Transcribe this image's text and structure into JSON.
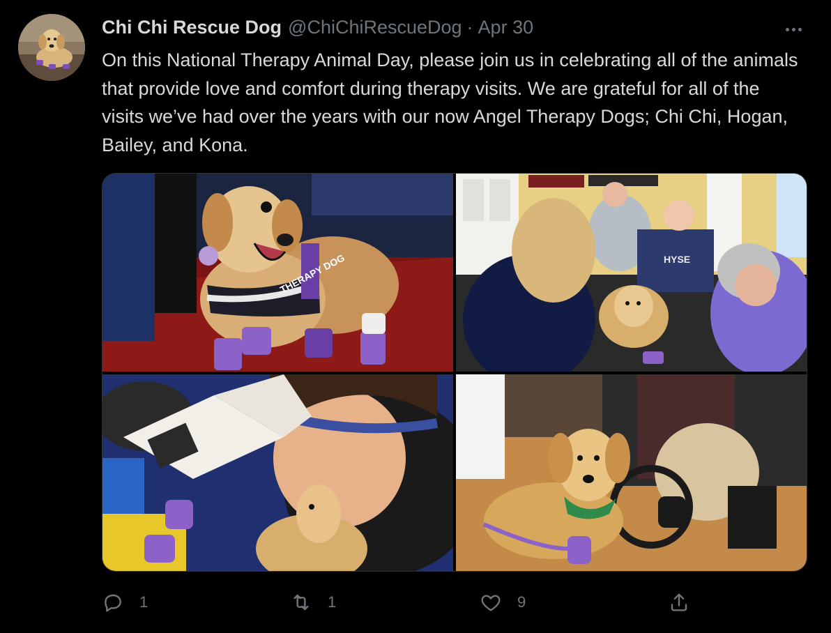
{
  "tweet": {
    "author_name": "Chi Chi Rescue Dog",
    "handle": "@ChiChiRescueDog",
    "separator": "·",
    "date": "Apr 30",
    "text": "On this National Therapy Animal Day, please join us in celebrating all of the animals that provide love and comfort during therapy visits. We are grateful for all of the visits we’ve had over the years with our now Angel Therapy Dogs; Chi Chi, Hogan, Bailey, and Kona."
  },
  "media": {
    "photo1": {
      "vest_label": "THERAPY DOG"
    },
    "photo2": {
      "shirt_label": "HYSE"
    }
  },
  "actions": {
    "reply_count": "1",
    "retweet_count": "1",
    "like_count": "9",
    "share_count": ""
  },
  "icons": {
    "more": "more-horizontal-icon",
    "reply": "reply-icon",
    "retweet": "retweet-icon",
    "like": "heart-icon",
    "share": "share-icon"
  },
  "colors": {
    "background": "#000000",
    "text": "#d9d9d9",
    "secondary": "#6e767d",
    "border": "#2f3336"
  }
}
